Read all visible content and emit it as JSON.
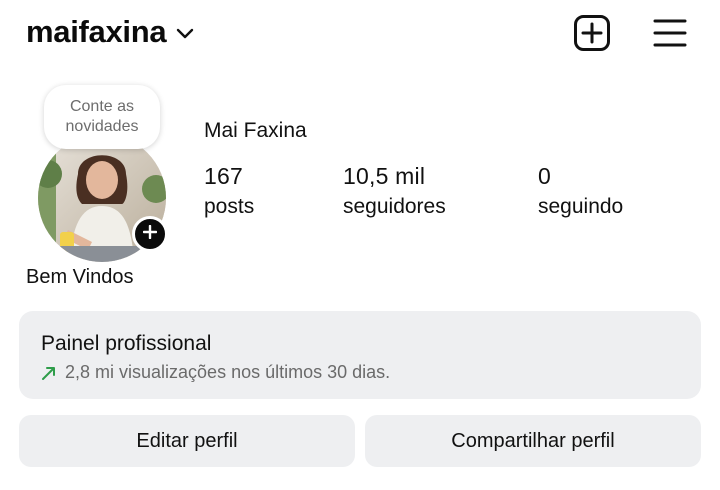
{
  "header": {
    "username": "maifaxina",
    "icons": {
      "dropdown": "chevron-down-icon",
      "create": "new-post-icon",
      "menu": "hamburger-menu-icon"
    }
  },
  "profile": {
    "note": "Conte as novidades",
    "full_name": "Mai Faxina",
    "stats": [
      {
        "value": "167",
        "label": "posts"
      },
      {
        "value": "10,5 mil",
        "label": "seguidores"
      },
      {
        "value": "0",
        "label": "seguindo"
      }
    ],
    "bio": "Bem Vindos"
  },
  "panel": {
    "title": "Painel profissional",
    "subtitle": "2,8 mi visualizações nos últimos 30 dias.",
    "trend_color": "#2e9d4a"
  },
  "actions": {
    "edit": "Editar perfil",
    "share": "Compartilhar perfil"
  }
}
